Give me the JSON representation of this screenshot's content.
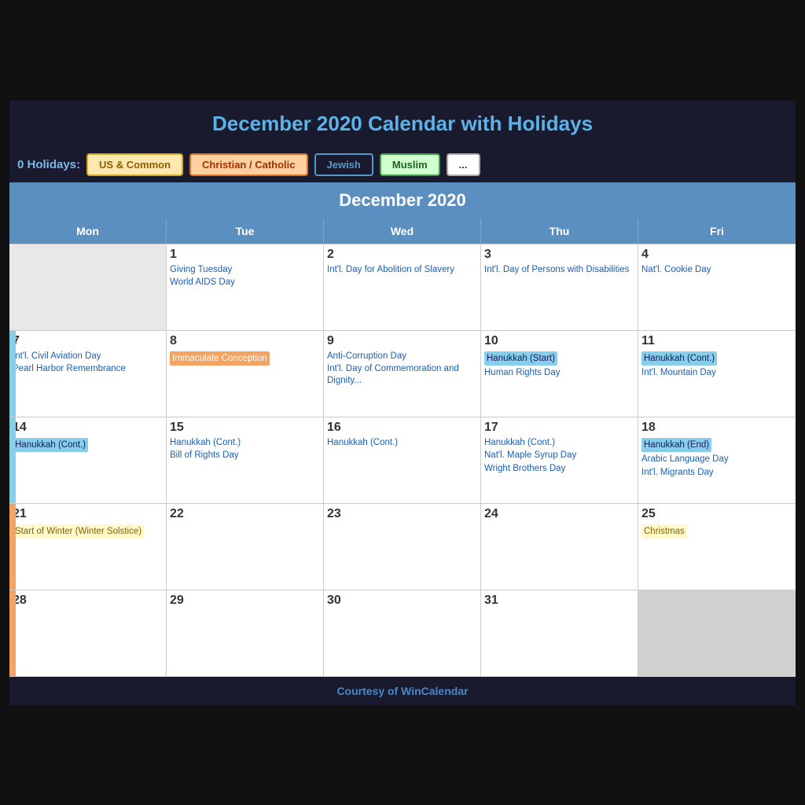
{
  "page": {
    "title": "December 2020 Calendar with Holidays",
    "month_label": "December 2020",
    "courtesy": "Courtesy of WinCalendar"
  },
  "filter_bar": {
    "label": "0 Holidays:",
    "buttons": [
      {
        "label": "US & Common",
        "style": "us"
      },
      {
        "label": "Christian / Catholic",
        "style": "christian"
      },
      {
        "label": "Jewish",
        "style": "jewish"
      },
      {
        "label": "Muslim",
        "style": "muslim"
      },
      {
        "label": "...",
        "style": "other"
      }
    ]
  },
  "day_headers": [
    "Mon",
    "Tue",
    "Wed",
    "Thu",
    "Fri"
  ],
  "weeks": [
    {
      "cells": [
        {
          "date": "",
          "empty": true,
          "events": []
        },
        {
          "date": "1",
          "events": [
            {
              "text": "Giving Tuesday",
              "style": "plain"
            },
            {
              "text": "World AIDS Day",
              "style": "plain"
            }
          ]
        },
        {
          "date": "2",
          "events": [
            {
              "text": "Int'l. Day for Abolition of Slavery",
              "style": "plain"
            }
          ]
        },
        {
          "date": "3",
          "events": [
            {
              "text": "Int'l. Day of Persons with Disabilities",
              "style": "plain"
            }
          ]
        },
        {
          "date": "4",
          "events": [
            {
              "text": "Nat'l. Cookie Day",
              "style": "plain"
            }
          ]
        }
      ]
    },
    {
      "cells": [
        {
          "date": "7",
          "side": "blue",
          "events": [
            {
              "text": "Int'l. Civil Aviation Day",
              "style": "plain"
            },
            {
              "text": "Pearl Harbor Remembrance",
              "style": "plain"
            }
          ]
        },
        {
          "date": "8",
          "events": [
            {
              "text": "Immaculate Conception",
              "style": "orange"
            }
          ]
        },
        {
          "date": "9",
          "events": [
            {
              "text": "Anti-Corruption Day",
              "style": "plain"
            },
            {
              "text": "Int'l. Day of Commemoration and Dignity...",
              "style": "plain"
            }
          ]
        },
        {
          "date": "10",
          "events": [
            {
              "text": "Hanukkah (Start)",
              "style": "blue"
            },
            {
              "text": "Human Rights Day",
              "style": "plain"
            }
          ]
        },
        {
          "date": "11",
          "events": [
            {
              "text": "Hanukkah (Cont.)",
              "style": "blue"
            },
            {
              "text": "Int'l. Mountain Day",
              "style": "plain"
            }
          ]
        }
      ]
    },
    {
      "cells": [
        {
          "date": "14",
          "side": "blue",
          "events": [
            {
              "text": "Hanukkah (Cont.)",
              "style": "blue"
            }
          ]
        },
        {
          "date": "15",
          "events": [
            {
              "text": "Hanukkah (Cont.)",
              "style": "plain"
            },
            {
              "text": "Bill of Rights Day",
              "style": "plain"
            }
          ]
        },
        {
          "date": "16",
          "events": [
            {
              "text": "Hanukkah (Cont.)",
              "style": "plain"
            }
          ]
        },
        {
          "date": "17",
          "events": [
            {
              "text": "Hanukkah (Cont.)",
              "style": "plain"
            },
            {
              "text": "Nat'l. Maple Syrup Day",
              "style": "plain"
            },
            {
              "text": "Wright Brothers Day",
              "style": "plain"
            }
          ]
        },
        {
          "date": "18",
          "events": [
            {
              "text": "Hanukkah (End)",
              "style": "blue"
            },
            {
              "text": "Arabic Language Day",
              "style": "plain"
            },
            {
              "text": "Int'l. Migrants Day",
              "style": "plain"
            }
          ]
        }
      ]
    },
    {
      "cells": [
        {
          "date": "21",
          "side": "orange",
          "extra_left": "nt",
          "events": [
            {
              "text": "Start of Winter (Winter Solstice)",
              "style": "yellow"
            }
          ]
        },
        {
          "date": "22",
          "events": []
        },
        {
          "date": "23",
          "events": []
        },
        {
          "date": "24",
          "events": []
        },
        {
          "date": "25",
          "events": [
            {
              "text": "Christmas",
              "style": "yellow"
            }
          ]
        }
      ]
    },
    {
      "cells": [
        {
          "date": "28",
          "side": "orange",
          "events": []
        },
        {
          "date": "29",
          "events": []
        },
        {
          "date": "30",
          "events": []
        },
        {
          "date": "31",
          "events": []
        },
        {
          "date": "",
          "empty": true,
          "gray": true,
          "events": []
        }
      ]
    }
  ]
}
